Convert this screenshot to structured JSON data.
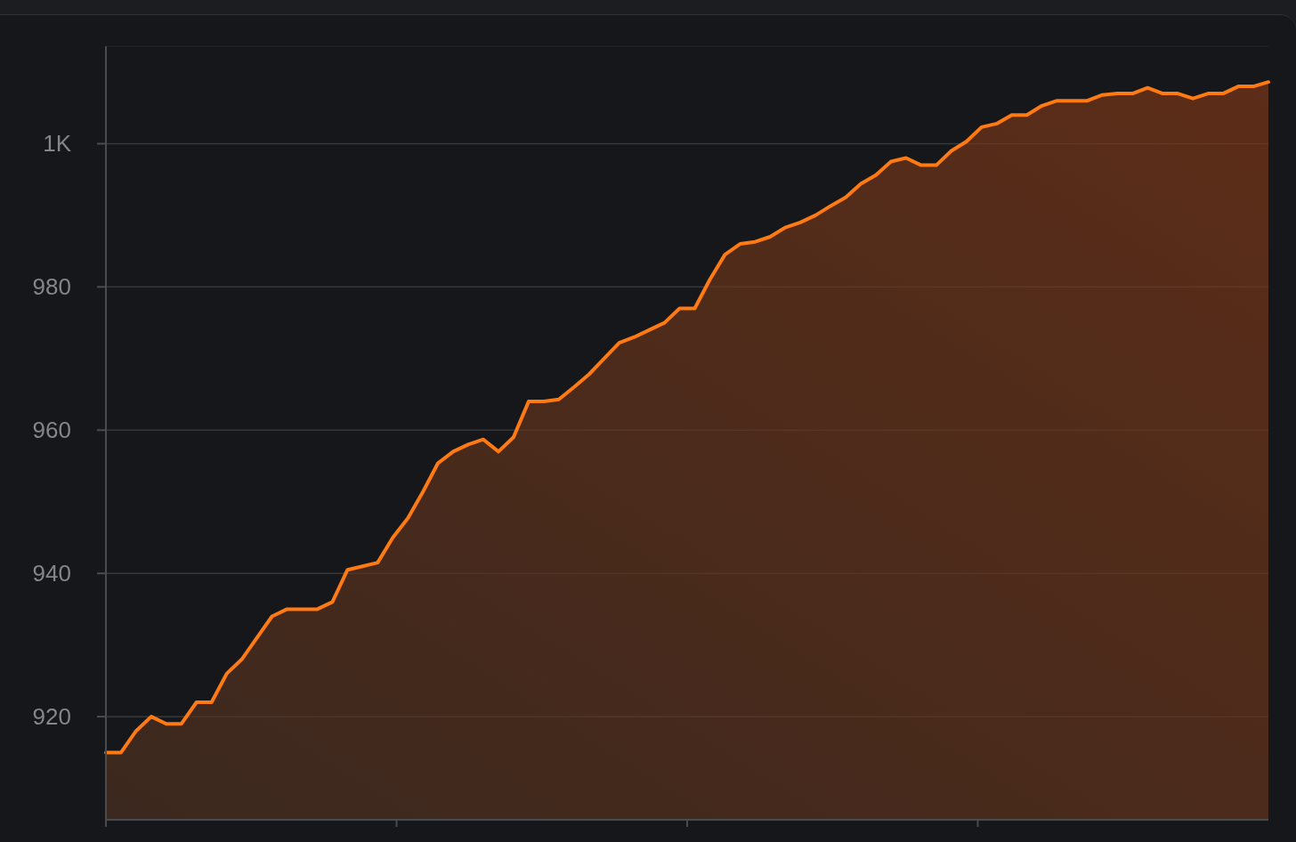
{
  "chart": {
    "chart_data": {
      "type": "area",
      "categories": [
        null,
        null,
        null,
        null,
        null,
        null,
        null,
        null,
        null,
        null,
        null,
        null,
        null,
        null,
        null,
        null,
        null,
        null,
        null,
        null,
        null,
        null,
        null,
        null,
        null,
        null,
        null,
        null,
        null,
        null,
        null,
        null,
        null,
        null,
        null,
        null,
        null,
        null,
        null,
        null,
        null,
        null,
        null,
        null,
        null,
        null,
        null,
        null,
        null,
        null,
        null,
        null,
        null,
        null,
        null,
        null,
        null,
        null,
        null,
        null,
        null,
        null,
        null,
        null,
        null,
        null,
        null,
        null,
        null,
        null,
        null,
        null,
        null,
        null,
        null,
        null,
        null,
        null
      ],
      "series": [
        {
          "color": "#ff7a12",
          "values": [
            915,
            915,
            918,
            920,
            919,
            919,
            922,
            922,
            926,
            928,
            931,
            934,
            935,
            935,
            935,
            936,
            940.5,
            941,
            941.5,
            945,
            947.7,
            951.4,
            955.4,
            957,
            958,
            958.7,
            957,
            959,
            964,
            964,
            964.3,
            966,
            967.8,
            970,
            972.2,
            973,
            974,
            975,
            977,
            977,
            981,
            984.5,
            986,
            986.3,
            987,
            988.3,
            989,
            990,
            991.3,
            992.5,
            994.4,
            995.6,
            997.5,
            998,
            997,
            997,
            999,
            1000.3,
            1002.3,
            1002.8,
            1004,
            1004,
            1005.3,
            1006,
            1006,
            1006,
            1006.8,
            1007,
            1007,
            1007.8,
            1007,
            1007,
            1006.3,
            1007,
            1007,
            1008,
            1008,
            1008.6
          ]
        }
      ],
      "ylim": [
        905.6,
        1013.6
      ],
      "grid": true,
      "yticks": [
        {
          "value": 920,
          "label": "920"
        },
        {
          "value": 940,
          "label": "940"
        },
        {
          "value": 960,
          "label": "960"
        },
        {
          "value": 980,
          "label": "980"
        },
        {
          "value": 1000,
          "label": "1K"
        }
      ]
    }
  }
}
